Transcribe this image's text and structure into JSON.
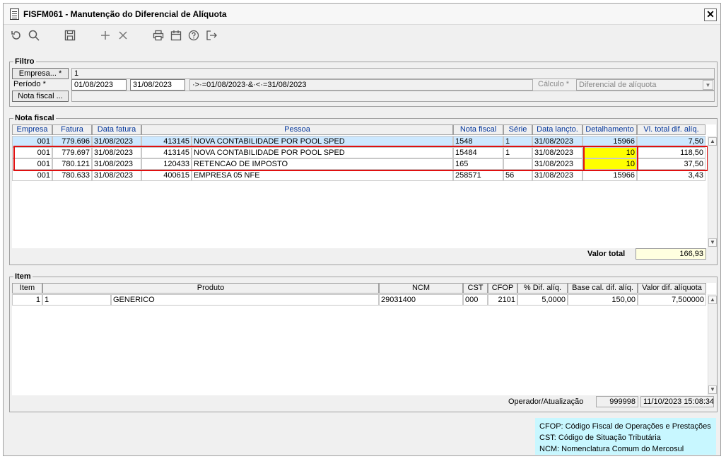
{
  "window": {
    "title": "FISFM061 - Manutenção do Diferencial de Alíquota",
    "close": "✕"
  },
  "toolbar": {
    "icons": [
      "refresh-icon",
      "search-icon",
      "save-icon",
      "add-icon",
      "delete-icon",
      "print-icon",
      "calendar-icon",
      "help-icon",
      "exit-icon"
    ]
  },
  "filtro": {
    "group_label": "Filtro",
    "empresa_button": "Empresa... *",
    "empresa_value": "1",
    "periodo_label": "Período *",
    "periodo_from": "01/08/2023",
    "periodo_to": "31/08/2023",
    "periodo_expr": "·>·=01/08/2023·&·<·=31/08/2023",
    "calculo_label": "Cálculo *",
    "calculo_value": "Diferencial de alíquota",
    "nota_button": "Nota fiscal ...",
    "nota_value": ""
  },
  "nota_fiscal": {
    "group_label": "Nota fiscal",
    "columns": [
      "Empresa",
      "Fatura",
      "Data fatura",
      "Pessoa",
      "Nota fiscal",
      "Série",
      "Data lançto.",
      "Detalhamento",
      "Vl. total dif. alíq."
    ],
    "rows": [
      {
        "empresa": "001",
        "fatura": "779.696",
        "data": "31/08/2023",
        "pessoa_cod": "413145",
        "pessoa": "NOVA CONTABILIDADE POR POOL SPED",
        "nota": "1548",
        "serie": "1",
        "lanc": "31/08/2023",
        "det": "15966",
        "total": "7,50"
      },
      {
        "empresa": "001",
        "fatura": "779.697",
        "data": "31/08/2023",
        "pessoa_cod": "413145",
        "pessoa": "NOVA CONTABILIDADE POR POOL SPED",
        "nota": "15484",
        "serie": "1",
        "lanc": "31/08/2023",
        "det": "10",
        "total": "118,50"
      },
      {
        "empresa": "001",
        "fatura": "780.121",
        "data": "31/08/2023",
        "pessoa_cod": "120433",
        "pessoa": "RETENCAO DE IMPOSTO",
        "nota": "165",
        "serie": "",
        "lanc": "31/08/2023",
        "det": "10",
        "total": "37,50"
      },
      {
        "empresa": "001",
        "fatura": "780.633",
        "data": "31/08/2023",
        "pessoa_cod": "400615",
        "pessoa": "EMPRESA 05 NFE",
        "nota": "258571",
        "serie": "56",
        "lanc": "31/08/2023",
        "det": "15966",
        "total": "3,43"
      }
    ],
    "valor_total_label": "Valor total",
    "valor_total": "166,93"
  },
  "item": {
    "group_label": "Item",
    "columns": [
      "Item",
      "Produto",
      "NCM",
      "CST",
      "CFOP",
      "% Dif. alíq.",
      "Base cal. dif. alíq.",
      "Valor dif. alíquota"
    ],
    "rows": [
      {
        "item": "1",
        "prod_cod": "1",
        "produto": "GENERICO",
        "ncm": "29031400",
        "cst": "000",
        "cfop": "2101",
        "pct": "5,0000",
        "base": "150,00",
        "valor": "7,500000"
      }
    ],
    "operador_label": "Operador/Atualização",
    "operador": "999998",
    "atualizacao": "11/10/2023 15:08:34"
  },
  "legend": [
    "CFOP: Código Fiscal de Operações e Prestações",
    "CST: Código de Situação Tributária",
    "NCM: Nomenclatura Comum do Mercosul"
  ],
  "colors": {
    "highlight": "#ffff00",
    "selected_row": "#cce8ff",
    "red_box": "#e01010",
    "legend_bg": "#c8f7ff"
  }
}
